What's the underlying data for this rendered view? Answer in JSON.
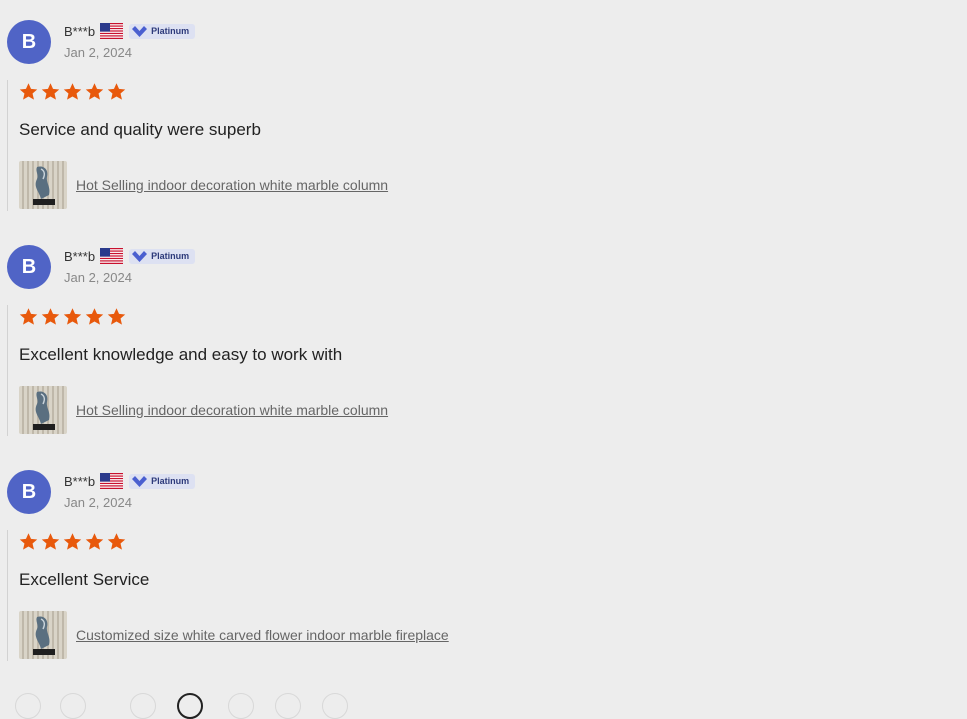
{
  "reviews": [
    {
      "avatar_letter": "B",
      "username": "B***b",
      "badge": "Platinum",
      "date": "Jan 2, 2024",
      "rating": 5,
      "text": "Service and quality were superb",
      "product": "Hot Selling indoor decoration white marble column"
    },
    {
      "avatar_letter": "B",
      "username": "B***b",
      "badge": "Platinum",
      "date": "Jan 2, 2024",
      "rating": 5,
      "text": "Excellent knowledge and easy to work with",
      "product": "Hot Selling indoor decoration white marble column"
    },
    {
      "avatar_letter": "B",
      "username": "B***b",
      "badge": "Platinum",
      "date": "Jan 2, 2024",
      "rating": 5,
      "text": "Excellent Service",
      "product": "Customized size white carved flower indoor marble fireplace"
    }
  ],
  "colors": {
    "avatar": "#5064c6",
    "star": "#e8590c",
    "badge_check": "#4a5fd0"
  },
  "icons": {
    "flag": "us-flag-icon",
    "badge": "verified-check-icon",
    "star": "star-icon"
  }
}
